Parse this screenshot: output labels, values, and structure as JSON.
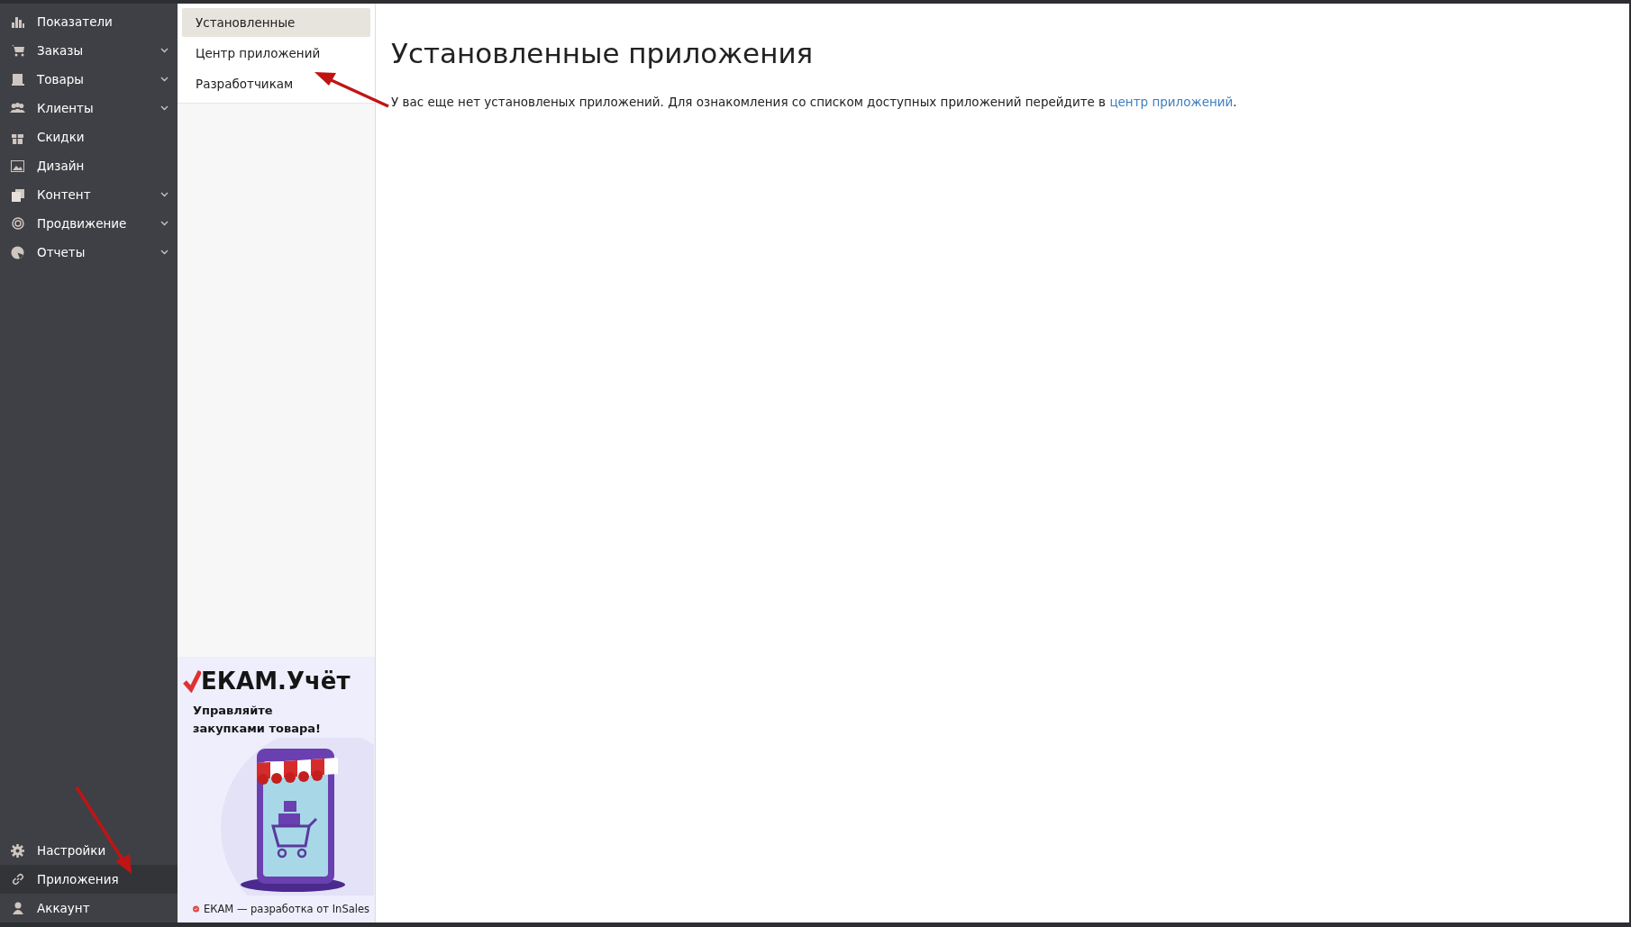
{
  "sidebar": {
    "items": [
      {
        "label": "Показатели",
        "expandable": false,
        "selected": false
      },
      {
        "label": "Заказы",
        "expandable": true,
        "selected": false
      },
      {
        "label": "Товары",
        "expandable": true,
        "selected": false
      },
      {
        "label": "Клиенты",
        "expandable": true,
        "selected": false
      },
      {
        "label": "Скидки",
        "expandable": false,
        "selected": false
      },
      {
        "label": "Дизайн",
        "expandable": false,
        "selected": false
      },
      {
        "label": "Контент",
        "expandable": true,
        "selected": false
      },
      {
        "label": "Продвижение",
        "expandable": true,
        "selected": false
      },
      {
        "label": "Отчеты",
        "expandable": true,
        "selected": false
      }
    ],
    "bottom_items": [
      {
        "label": "Настройки",
        "selected": false
      },
      {
        "label": "Приложения",
        "selected": true
      },
      {
        "label": "Аккаунт",
        "selected": false
      }
    ]
  },
  "submenu": [
    {
      "label": "Установленные",
      "selected": true
    },
    {
      "label": "Центр приложений",
      "selected": false
    },
    {
      "label": "Разработчикам",
      "selected": false
    }
  ],
  "banner": {
    "logo": "ЕКАМ.Учёт",
    "tagline": "Управляйте закупками товара!",
    "footer": "ЕКАМ — разработка от InSales"
  },
  "main": {
    "title": "Установленные приложения",
    "text": "У вас еще нет установленых приложений. Для ознакомления со списком доступных приложений перейдите в ",
    "link": "центр приложений",
    "text_end": "."
  }
}
